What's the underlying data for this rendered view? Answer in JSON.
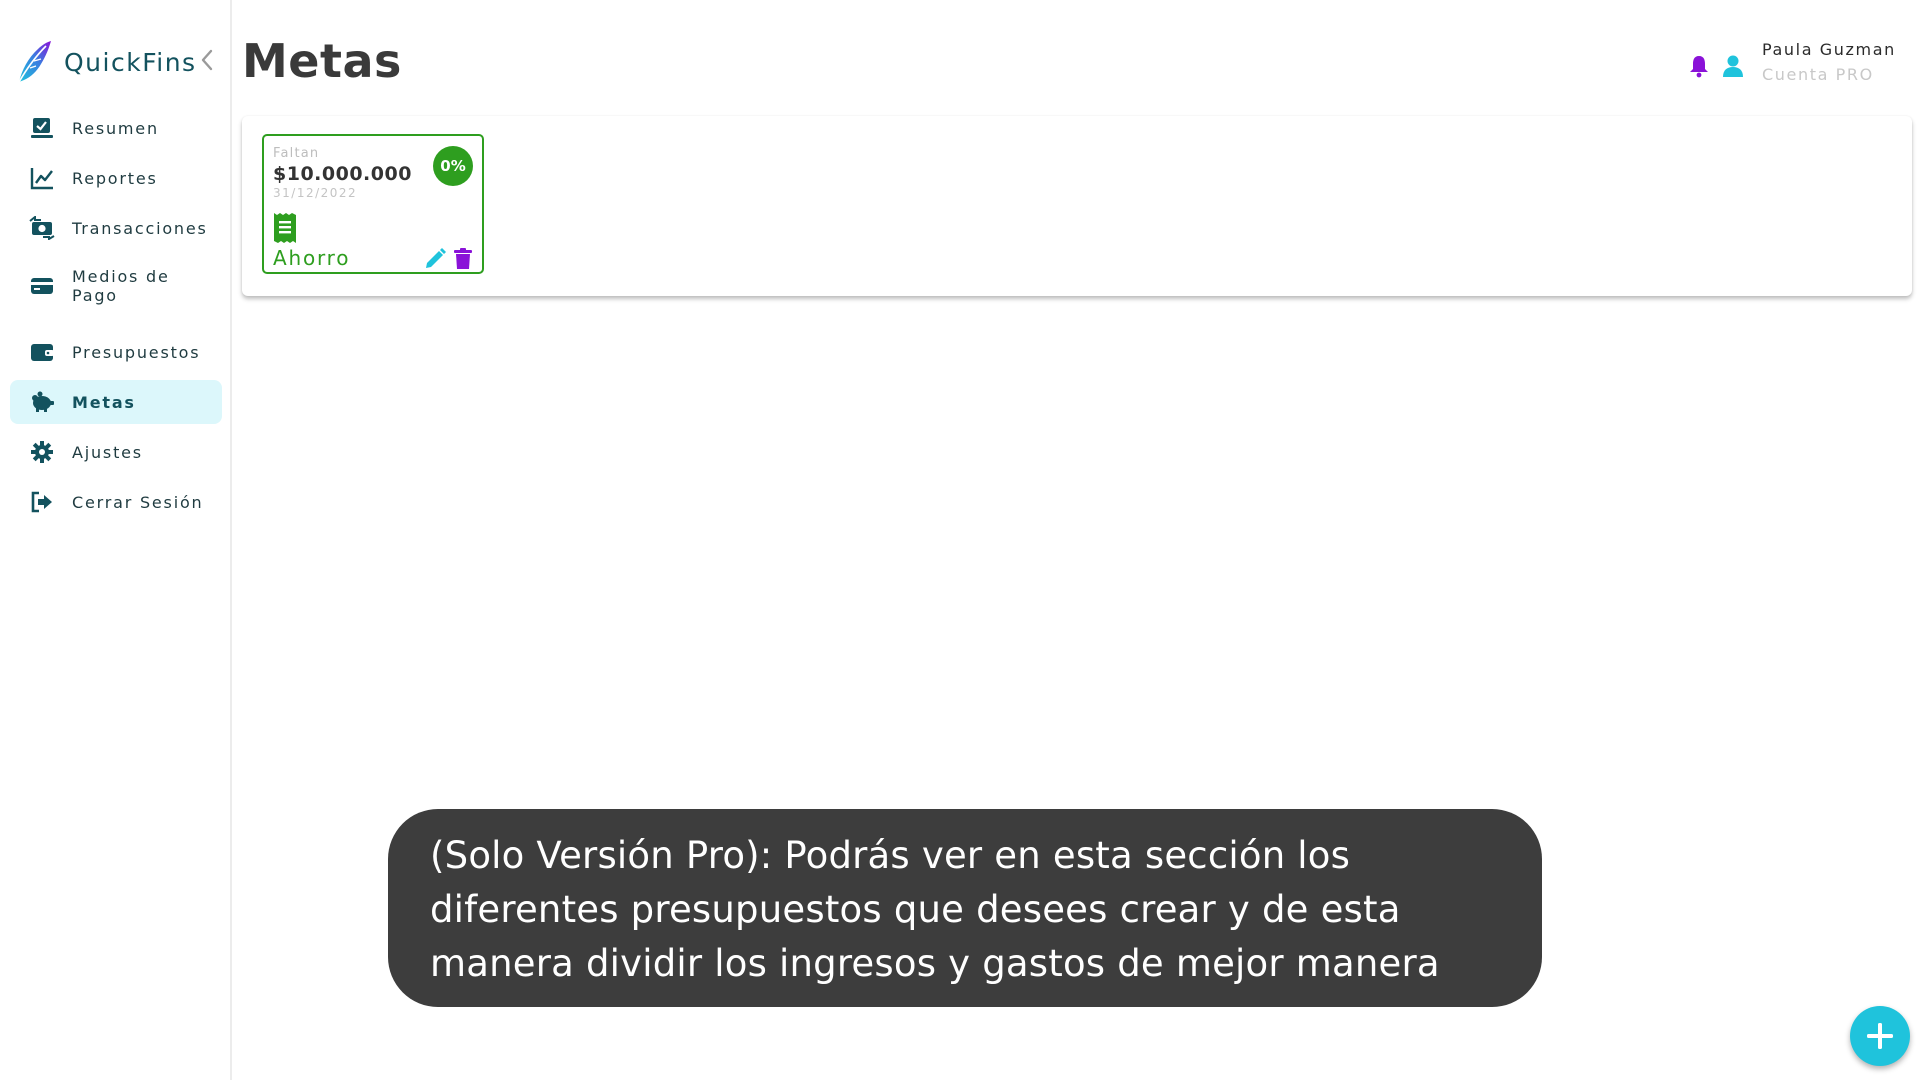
{
  "app": {
    "name": "QuickFins"
  },
  "sidebar": {
    "items": [
      {
        "label": "Resumen",
        "icon": "chart-check-icon"
      },
      {
        "label": "Reportes",
        "icon": "line-chart-icon"
      },
      {
        "label": "Transacciones",
        "icon": "money-exchange-icon"
      },
      {
        "label": "Medios de Pago",
        "icon": "credit-card-icon"
      },
      {
        "label": "Presupuestos",
        "icon": "wallet-icon"
      },
      {
        "label": "Metas",
        "icon": "piggy-bank-icon",
        "active": true
      },
      {
        "label": "Ajustes",
        "icon": "gear-icon"
      },
      {
        "label": "Cerrar Sesión",
        "icon": "logout-icon"
      }
    ]
  },
  "header": {
    "title": "Metas",
    "user_name": "Paula Guzman",
    "user_plan": "Cuenta PRO"
  },
  "goal_card": {
    "remaining_label": "Faltan",
    "amount": "$10.000.000",
    "date": "31/12/2022",
    "progress_label": "0%",
    "progress_percent": 0,
    "name": "Ahorro"
  },
  "tooltip": {
    "text": "(Solo Versión Pro): Podrás ver en esta sección los diferentes presupuestos que desees crear y de esta manera dividir los ingresos y gastos de mejor manera"
  },
  "colors": {
    "primary_dark": "#13525e",
    "accent_cyan": "#1fc3dc",
    "accent_purple": "#8a12d8",
    "goal_green": "#2e9e1f",
    "active_bg": "#dcf7fb",
    "tooltip_bg": "#3d3d3d"
  }
}
